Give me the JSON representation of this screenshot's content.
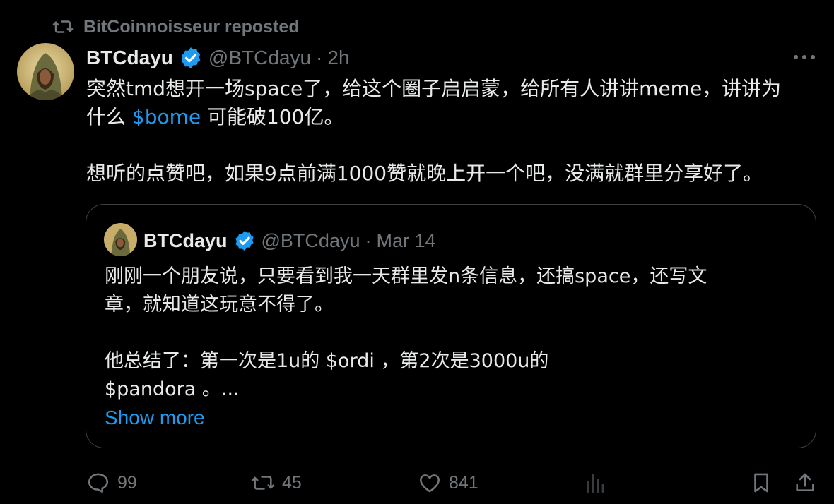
{
  "repost": {
    "text": "BitCoinnoisseur reposted",
    "icon": "repost-icon"
  },
  "tweet": {
    "author_name": "BTCdayu",
    "handle": "@BTCdayu",
    "separator": "·",
    "time": "2h",
    "text_line1": "突然tmd想开一场space了，给这个圈子启启蒙，给所有人讲讲meme，讲讲为",
    "text_line2_pre": "什么 ",
    "cashtag": "$bome",
    "text_line2_post": " 可能破100亿。",
    "text_para2": "想听的点赞吧，如果9点前满1000赞就晚上开一个吧，没满就群里分享好了。"
  },
  "quote": {
    "author_name": "BTCdayu",
    "handle": "@BTCdayu",
    "separator": "·",
    "time": "Mar 14",
    "line1": "刚刚一个朋友说，只要看到我一天群里发n条信息，还搞space，还写文",
    "line2": "章，就知道这玩意不得了。",
    "line3": "他总结了：第一次是1u的 $ordi ，第2次是3000u的",
    "line4": " $pandora 。...",
    "show_more": "Show more"
  },
  "actions": {
    "replies": "99",
    "reposts": "45",
    "likes": "841"
  },
  "colors": {
    "background": "#000000",
    "text": "#e7e9ea",
    "muted": "#71767b",
    "accent": "#1d9bf0",
    "border": "#3e4144"
  }
}
